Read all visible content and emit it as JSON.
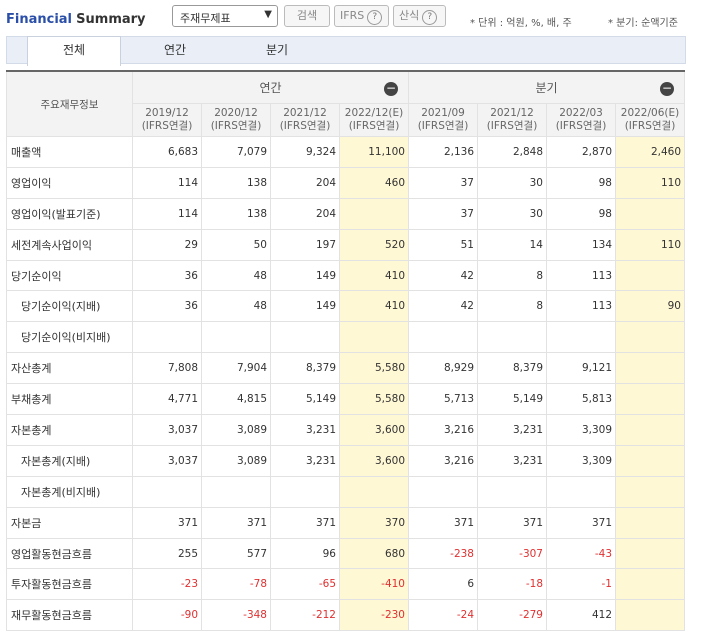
{
  "header": {
    "title_part1": "Financial",
    "title_part2": "Summary",
    "select_value": "주재무제표",
    "search_label": "검색",
    "ifrs_label": "IFRS",
    "calc_label": "산식",
    "help_symbol": "?",
    "unit_note": "* 단위 : 억원, %, 배, 주",
    "period_note": "* 분기: 순액기준"
  },
  "tabs": [
    "전체",
    "연간",
    "분기"
  ],
  "table": {
    "corner_label": "주요재무정보",
    "group_annual": "연간",
    "group_quarter": "분기",
    "collapse_symbol": "−",
    "periods": [
      {
        "date": "2019/12",
        "basis": "(IFRS연결)",
        "estimate": false
      },
      {
        "date": "2020/12",
        "basis": "(IFRS연결)",
        "estimate": false
      },
      {
        "date": "2021/12",
        "basis": "(IFRS연결)",
        "estimate": false
      },
      {
        "date": "2022/12(E)",
        "basis": "(IFRS연결)",
        "estimate": true
      },
      {
        "date": "2021/09",
        "basis": "(IFRS연결)",
        "estimate": false
      },
      {
        "date": "2021/12",
        "basis": "(IFRS연결)",
        "estimate": false
      },
      {
        "date": "2022/03",
        "basis": "(IFRS연결)",
        "estimate": false
      },
      {
        "date": "2022/06(E)",
        "basis": "(IFRS연결)",
        "estimate": true
      }
    ],
    "rows": [
      {
        "label": "매출액",
        "sub": false,
        "values": [
          "6,683",
          "7,079",
          "9,324",
          "11,100",
          "2,136",
          "2,848",
          "2,870",
          "2,460"
        ]
      },
      {
        "label": "영업이익",
        "sub": false,
        "values": [
          "114",
          "138",
          "204",
          "460",
          "37",
          "30",
          "98",
          "110"
        ]
      },
      {
        "label": "영업이익(발표기준)",
        "sub": false,
        "values": [
          "114",
          "138",
          "204",
          "",
          "37",
          "30",
          "98",
          ""
        ]
      },
      {
        "label": "세전계속사업이익",
        "sub": false,
        "values": [
          "29",
          "50",
          "197",
          "520",
          "51",
          "14",
          "134",
          "110"
        ]
      },
      {
        "label": "당기순이익",
        "sub": false,
        "values": [
          "36",
          "48",
          "149",
          "410",
          "42",
          "8",
          "113",
          ""
        ]
      },
      {
        "label": "당기순이익(지배)",
        "sub": true,
        "values": [
          "36",
          "48",
          "149",
          "410",
          "42",
          "8",
          "113",
          "90"
        ]
      },
      {
        "label": "당기순이익(비지배)",
        "sub": true,
        "values": [
          "",
          "",
          "",
          "",
          "",
          "",
          "",
          ""
        ]
      },
      {
        "label": "자산총계",
        "sub": false,
        "values": [
          "7,808",
          "7,904",
          "8,379",
          "5,580",
          "8,929",
          "8,379",
          "9,121",
          ""
        ]
      },
      {
        "label": "부채총계",
        "sub": false,
        "values": [
          "4,771",
          "4,815",
          "5,149",
          "5,580",
          "5,713",
          "5,149",
          "5,813",
          ""
        ]
      },
      {
        "label": "자본총계",
        "sub": false,
        "values": [
          "3,037",
          "3,089",
          "3,231",
          "3,600",
          "3,216",
          "3,231",
          "3,309",
          ""
        ]
      },
      {
        "label": "자본총계(지배)",
        "sub": true,
        "values": [
          "3,037",
          "3,089",
          "3,231",
          "3,600",
          "3,216",
          "3,231",
          "3,309",
          ""
        ]
      },
      {
        "label": "자본총계(비지배)",
        "sub": true,
        "values": [
          "",
          "",
          "",
          "",
          "",
          "",
          "",
          ""
        ]
      },
      {
        "label": "자본금",
        "sub": false,
        "values": [
          "371",
          "371",
          "371",
          "370",
          "371",
          "371",
          "371",
          ""
        ]
      },
      {
        "label": "영업활동현금흐름",
        "sub": false,
        "values": [
          "255",
          "577",
          "96",
          "680",
          "-238",
          "-307",
          "-43",
          ""
        ]
      },
      {
        "label": "투자활동현금흐름",
        "sub": false,
        "values": [
          "-23",
          "-78",
          "-65",
          "-410",
          "6",
          "-18",
          "-1",
          ""
        ]
      },
      {
        "label": "재무활동현금흐름",
        "sub": false,
        "values": [
          "-90",
          "-348",
          "-212",
          "-230",
          "-24",
          "-279",
          "412",
          ""
        ]
      }
    ]
  }
}
